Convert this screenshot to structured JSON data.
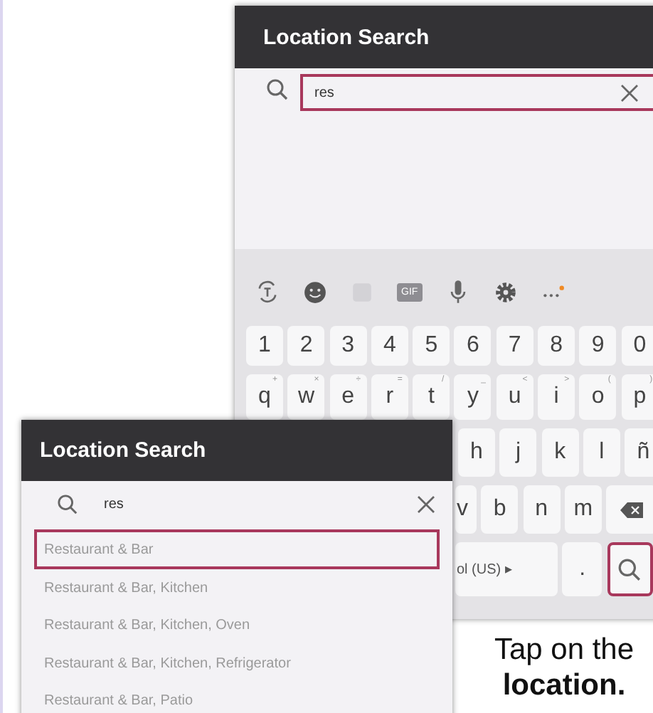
{
  "back_screen": {
    "title": "Location Search",
    "search": {
      "value": "res",
      "highlighted": true
    },
    "toolbar": [
      {
        "kind": "text-cycle"
      },
      {
        "kind": "emoji"
      },
      {
        "kind": "sticker"
      },
      {
        "kind": "gif",
        "label": "GIF"
      },
      {
        "kind": "mic"
      },
      {
        "kind": "settings"
      },
      {
        "kind": "more"
      }
    ],
    "keyboard_rows": [
      {
        "keys": [
          {
            "label": "1"
          },
          {
            "label": "2"
          },
          {
            "label": "3"
          },
          {
            "label": "4"
          },
          {
            "label": "5"
          },
          {
            "label": "6"
          },
          {
            "label": "7"
          },
          {
            "label": "8"
          },
          {
            "label": "9"
          },
          {
            "label": "0"
          }
        ]
      },
      {
        "keys": [
          {
            "label": "q",
            "hint": "+"
          },
          {
            "label": "w",
            "hint": "×"
          },
          {
            "label": "e",
            "hint": "÷"
          },
          {
            "label": "r",
            "hint": "="
          },
          {
            "label": "t",
            "hint": "/"
          },
          {
            "label": "y",
            "hint": "_"
          },
          {
            "label": "u",
            "hint": "<"
          },
          {
            "label": "i",
            "hint": ">"
          },
          {
            "label": "o",
            "hint": "("
          },
          {
            "label": "p",
            "hint": ")"
          }
        ]
      },
      {
        "keys": [
          {
            "label": "h"
          },
          {
            "label": "j"
          },
          {
            "label": "k"
          },
          {
            "label": "l"
          },
          {
            "label": "ñ"
          }
        ]
      },
      {
        "keys": [
          {
            "label": "v"
          },
          {
            "label": "b"
          },
          {
            "label": "n"
          },
          {
            "label": "m"
          },
          {
            "kind": "backspace"
          }
        ]
      },
      {
        "keys": [
          {
            "kind": "language",
            "label": "ol (US) ▸"
          },
          {
            "label": "."
          },
          {
            "kind": "search",
            "highlighted": true
          }
        ]
      }
    ]
  },
  "front_screen": {
    "title": "Location Search",
    "search": {
      "value": "res"
    },
    "results": [
      {
        "label": "Restaurant & Bar",
        "selected": true
      },
      {
        "label": "Restaurant & Bar, Kitchen",
        "selected": false
      },
      {
        "label": "Restaurant & Bar, Kitchen, Oven",
        "selected": false
      },
      {
        "label": "Restaurant & Bar, Kitchen, Refrigerator",
        "selected": false
      },
      {
        "label": "Restaurant & Bar, Patio",
        "selected": false
      }
    ]
  },
  "caption": "Tap on the **location.**"
}
